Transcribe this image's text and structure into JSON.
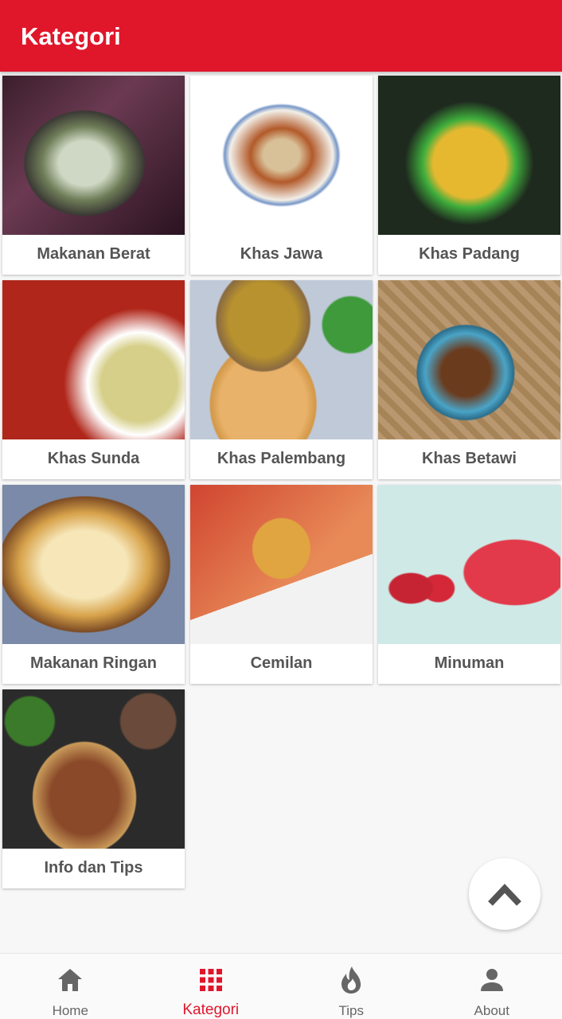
{
  "appbar": {
    "title": "Kategori"
  },
  "categories": [
    {
      "label": "Makanan Berat"
    },
    {
      "label": "Khas Jawa"
    },
    {
      "label": "Khas Padang"
    },
    {
      "label": "Khas Sunda"
    },
    {
      "label": "Khas Palembang"
    },
    {
      "label": "Khas Betawi"
    },
    {
      "label": "Makanan Ringan"
    },
    {
      "label": "Cemilan"
    },
    {
      "label": "Minuman"
    },
    {
      "label": "Info dan Tips"
    }
  ],
  "nav": {
    "items": [
      {
        "label": "Home",
        "icon": "home-icon"
      },
      {
        "label": "Kategori",
        "icon": "grid-icon",
        "active": true
      },
      {
        "label": "Tips",
        "icon": "flame-icon"
      },
      {
        "label": "About",
        "icon": "person-icon"
      }
    ]
  },
  "colors": {
    "primary": "#e0162b",
    "nav_inactive": "#666666"
  }
}
